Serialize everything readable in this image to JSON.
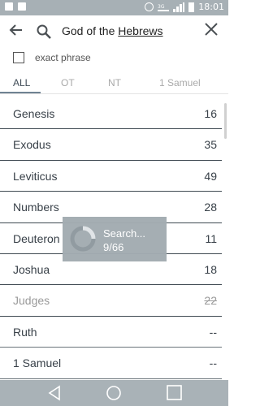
{
  "status_bar": {
    "time": "18:01"
  },
  "search": {
    "query_prefix": "God of the ",
    "query_underlined": "Hebrews"
  },
  "options": {
    "exact_phrase_label": "exact phrase",
    "exact_phrase_checked": false
  },
  "tabs": [
    {
      "label": "ALL",
      "active": true
    },
    {
      "label": "OT",
      "active": false
    },
    {
      "label": "NT",
      "active": false
    },
    {
      "label": "1 Samuel",
      "active": false
    }
  ],
  "books": [
    {
      "name": "Genesis",
      "count": "16"
    },
    {
      "name": "Exodus",
      "count": "35"
    },
    {
      "name": "Leviticus",
      "count": "49"
    },
    {
      "name": "Numbers",
      "count": "28"
    },
    {
      "name": "Deuteron",
      "count": "11"
    },
    {
      "name": "Joshua",
      "count": "18"
    },
    {
      "name": "Judges",
      "count": "22"
    },
    {
      "name": "Ruth",
      "count": "--"
    },
    {
      "name": "1 Samuel",
      "count": "--"
    }
  ],
  "progress": {
    "title": "Search...",
    "status": "9/66",
    "fraction": 0.136
  },
  "colors": {
    "status_bar": "#a7b0b5",
    "nav_bar": "#a9b2b7",
    "overlay": "#a3acb1",
    "row_divider": "#3f4a52"
  },
  "icons": [
    "back-arrow-icon",
    "search-icon",
    "close-icon",
    "checkbox-icon",
    "nav-back-icon",
    "nav-home-icon",
    "nav-recents-icon"
  ]
}
